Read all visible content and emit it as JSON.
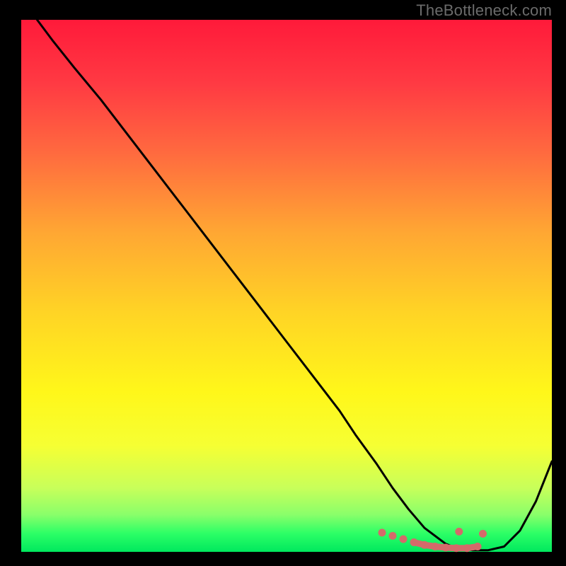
{
  "watermark": "TheBottleneck.com",
  "chart_data": {
    "type": "line",
    "title": "",
    "xlabel": "",
    "ylabel": "",
    "xlim": [
      0,
      100
    ],
    "ylim": [
      0,
      100
    ],
    "grid": false,
    "legend": false,
    "background": {
      "type": "vertical-gradient",
      "stops": [
        {
          "offset": 0.0,
          "color": "#ff1a3a"
        },
        {
          "offset": 0.12,
          "color": "#ff3a43"
        },
        {
          "offset": 0.25,
          "color": "#ff6a3f"
        },
        {
          "offset": 0.4,
          "color": "#ffa733"
        },
        {
          "offset": 0.55,
          "color": "#ffd425"
        },
        {
          "offset": 0.7,
          "color": "#fff71a"
        },
        {
          "offset": 0.8,
          "color": "#f6ff33"
        },
        {
          "offset": 0.88,
          "color": "#c8ff5a"
        },
        {
          "offset": 0.93,
          "color": "#8aff6a"
        },
        {
          "offset": 0.965,
          "color": "#2dff66"
        },
        {
          "offset": 1.0,
          "color": "#00e85e"
        }
      ]
    },
    "series": [
      {
        "name": "bottleneck-curve",
        "color": "#000000",
        "x": [
          3,
          6,
          10,
          15,
          20,
          25,
          30,
          35,
          40,
          45,
          50,
          55,
          60,
          63,
          67,
          70,
          73,
          76,
          80,
          82,
          85,
          88,
          91,
          94,
          97,
          100
        ],
        "y": [
          100,
          96,
          91,
          85,
          78.5,
          72,
          65.5,
          59,
          52.5,
          46,
          39.5,
          33,
          26.5,
          22,
          16.5,
          12,
          8,
          4.5,
          1.5,
          0.7,
          0.3,
          0.3,
          1.0,
          4,
          9.5,
          17
        ]
      }
    ],
    "highlight": {
      "name": "optimal-range",
      "color": "#d46a6a",
      "points_x": [
        68,
        70,
        72,
        74,
        76,
        78,
        80,
        82,
        84,
        86,
        87,
        82.5
      ],
      "points_y": [
        3.6,
        3.0,
        2.4,
        1.8,
        1.3,
        1.0,
        0.8,
        0.7,
        0.7,
        1.0,
        3.4,
        3.8
      ]
    }
  }
}
